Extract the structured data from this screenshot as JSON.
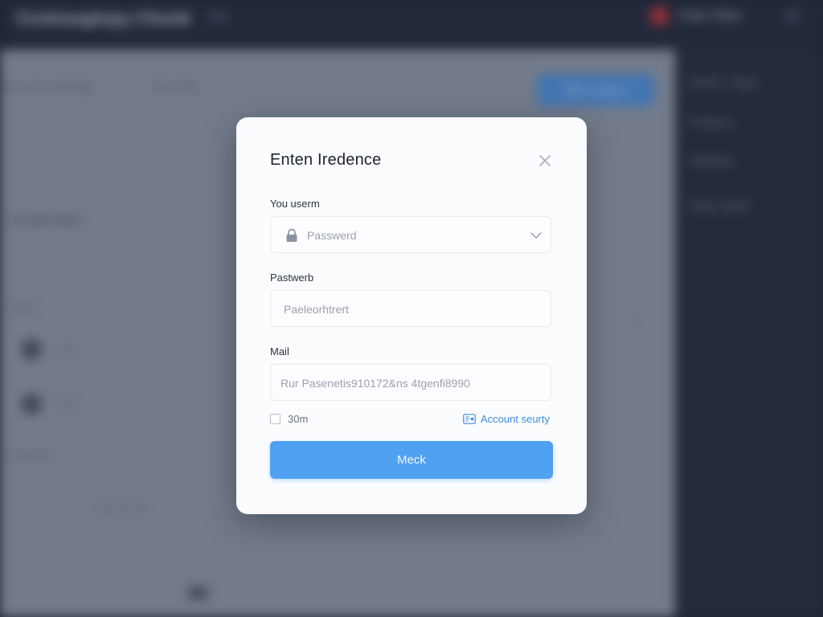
{
  "background": {
    "app_title": "Contrasgtopy Chunk",
    "app_subtitle": "File",
    "user_name": "Zoan Hfew",
    "top_icon": "⚙",
    "breadcrumb": [
      "Account settings",
      "Security"
    ],
    "action_button": "New session",
    "section_title": "Credentials",
    "sub_label": "Users",
    "rows": [
      "Apex",
      "Data"
    ],
    "footer_label": "Sessions",
    "pager": "Prev 1 of 3",
    "sidebar_items": [
      "Home / Apps",
      "Projects",
      "Settings",
      "Help center"
    ]
  },
  "modal": {
    "title": "Enten Iredence",
    "close_icon": "close-icon",
    "username_label": "You userm",
    "username_placeholder": "Passwerd",
    "password_label": "Pastwerb",
    "password_placeholder": "Paeleorhtrert",
    "mail_label": "Mail",
    "mail_placeholder": "Rur Pasenetis910172&ns 4tgenfi8990",
    "remember_label": "30m",
    "security_link": "Account seurty",
    "submit_label": "Meck"
  },
  "colors": {
    "accent": "#4fa1f2",
    "link": "#3d8be0",
    "danger": "#c0343a"
  }
}
